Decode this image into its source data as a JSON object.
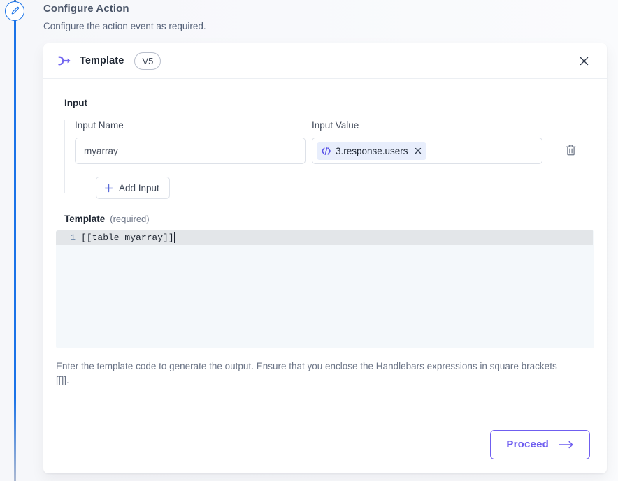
{
  "header": {
    "title": "Configure Action",
    "subtitle": "Configure the action event as required.",
    "step_icon": "pencil-icon"
  },
  "card": {
    "icon": "template-flow-icon",
    "title": "Template",
    "version_badge": "V5",
    "close_icon": "close-icon"
  },
  "input_section": {
    "section_label": "Input",
    "name_label": "Input Name",
    "value_label": "Input Value",
    "rows": [
      {
        "name_value": "myarray",
        "name_placeholder": "Input Name",
        "chip_icon": "code-brackets-icon",
        "chip_text": "3.response.users",
        "chip_remove_icon": "close-icon",
        "delete_icon": "trash-icon"
      }
    ],
    "add_button": {
      "icon": "plus-icon",
      "label": "Add Input"
    }
  },
  "template_section": {
    "label": "Template",
    "required_note": "(required)",
    "editor": {
      "line_number": "1",
      "code": "[[table myarray]]"
    },
    "helper_text": "Enter the template code to generate the output. Ensure that you enclose the Handlebars expressions in square brackets [[]]."
  },
  "footer": {
    "proceed_label": "Proceed",
    "proceed_icon": "arrow-right-icon"
  },
  "colors": {
    "accent_purple": "#6f5ef0",
    "rail_blue": "#1a73e8",
    "chip_bg": "#e8eefc",
    "editor_bg": "#f4f8fb",
    "active_line": "#e3e6e9"
  }
}
